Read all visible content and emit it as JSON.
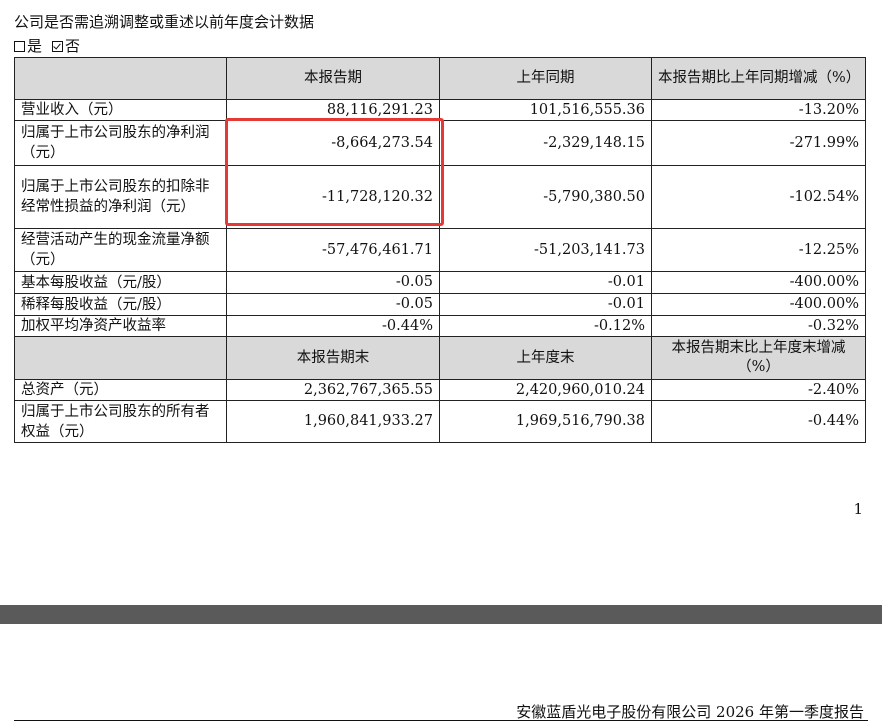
{
  "question": "公司是否需追溯调整或重述以前年度会计数据",
  "options": [
    {
      "label": "是",
      "checked": false
    },
    {
      "label": "否",
      "checked": true
    }
  ],
  "table": {
    "header1": [
      "",
      "本报告期",
      "上年同期",
      "本报告期比上年同期增减（%）"
    ],
    "rows1": [
      {
        "label": "营业收入（元）",
        "values": [
          "88,116,291.23",
          "101,516,555.36",
          "-13.20%"
        ]
      },
      {
        "label": "归属于上市公司股东的净利润（元）",
        "values": [
          "-8,664,273.54",
          "-2,329,148.15",
          "-271.99%"
        ]
      },
      {
        "label": "归属于上市公司股东的扣除非经常性损益的净利润（元）",
        "values": [
          "-11,728,120.32",
          "-5,790,380.50",
          "-102.54%"
        ]
      },
      {
        "label": "经营活动产生的现金流量净额（元）",
        "values": [
          "-57,476,461.71",
          "-51,203,141.73",
          "-12.25%"
        ]
      },
      {
        "label": "基本每股收益（元/股）",
        "values": [
          "-0.05",
          "-0.01",
          "-400.00%"
        ]
      },
      {
        "label": "稀释每股收益（元/股）",
        "values": [
          "-0.05",
          "-0.01",
          "-400.00%"
        ]
      },
      {
        "label": "加权平均净资产收益率",
        "values": [
          "-0.44%",
          "-0.12%",
          "-0.32%"
        ]
      }
    ],
    "header2": [
      "",
      "本报告期末",
      "上年度末",
      "本报告期末比上年度末增减（%）"
    ],
    "rows2": [
      {
        "label": "总资产（元）",
        "values": [
          "2,362,767,365.55",
          "2,420,960,010.24",
          "-2.40%"
        ]
      },
      {
        "label": "归属于上市公司股东的所有者权益（元）",
        "values": [
          "1,960,841,933.27",
          "1,969,516,790.38",
          "-0.44%"
        ]
      }
    ]
  },
  "page_number": "1",
  "footer": "安徽蓝盾光电子股份有限公司 2026 年第一季度报告",
  "colors": {
    "highlight_border": "#e53935",
    "header_fill": "#d9d9d9",
    "separator_bar": "#5a5a5a"
  }
}
